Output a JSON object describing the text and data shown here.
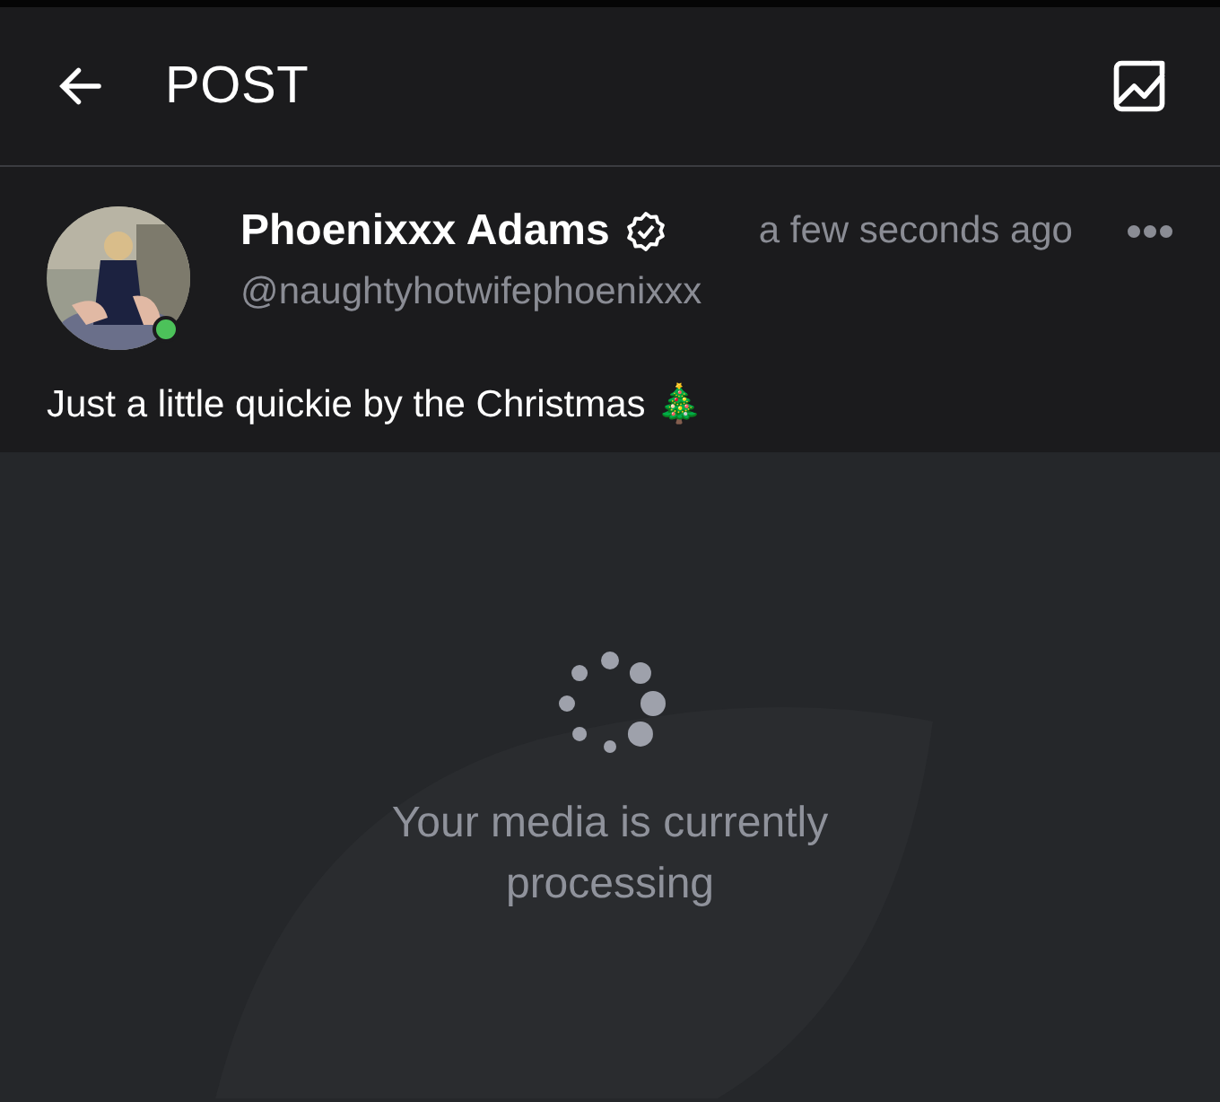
{
  "header": {
    "title": "POST"
  },
  "post": {
    "author": "Phoenixxx Adams",
    "verified": true,
    "time": "a few seconds ago",
    "handle": "@naughtyhotwifephoenixxx",
    "online": true,
    "text": "Just a little quickie by the Christmas 🎄"
  },
  "media": {
    "message": "Your media is currently processing"
  }
}
